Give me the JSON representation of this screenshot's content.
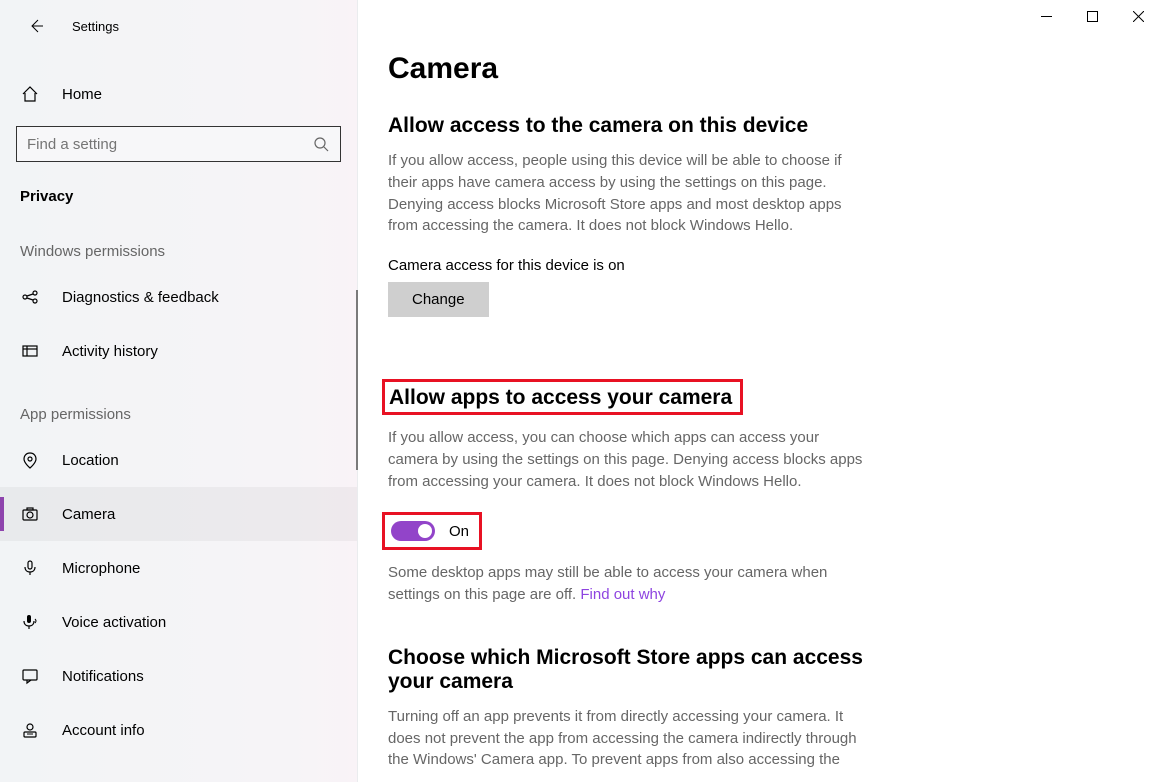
{
  "app_title": "Settings",
  "home_label": "Home",
  "search": {
    "placeholder": "Find a setting"
  },
  "page_section": "Privacy",
  "groups": {
    "windows_permissions": {
      "header": "Windows permissions",
      "items": [
        {
          "label": "Diagnostics & feedback"
        },
        {
          "label": "Activity history"
        }
      ]
    },
    "app_permissions": {
      "header": "App permissions",
      "items": [
        {
          "label": "Location"
        },
        {
          "label": "Camera",
          "selected": true
        },
        {
          "label": "Microphone"
        },
        {
          "label": "Voice activation"
        },
        {
          "label": "Notifications"
        },
        {
          "label": "Account info"
        }
      ]
    }
  },
  "main": {
    "title": "Camera",
    "section1": {
      "heading": "Allow access to the camera on this device",
      "body": "If you allow access, people using this device will be able to choose if their apps have camera access by using the settings on this page. Denying access blocks Microsoft Store apps and most desktop apps from accessing the camera. It does not block Windows Hello.",
      "status": "Camera access for this device is on",
      "button": "Change"
    },
    "section2": {
      "heading": "Allow apps to access your camera",
      "body": "If you allow access, you can choose which apps can access your camera by using the settings on this page. Denying access blocks apps from accessing your camera. It does not block Windows Hello.",
      "toggle_state": "On",
      "note_pre": "Some desktop apps may still be able to access your camera when settings on this page are off. ",
      "note_link": "Find out why"
    },
    "section3": {
      "heading": "Choose which Microsoft Store apps can access your camera",
      "body": "Turning off an app prevents it from directly accessing your camera. It does not prevent the app from accessing the camera indirectly through the Windows' Camera app. To prevent apps from also accessing the"
    }
  }
}
